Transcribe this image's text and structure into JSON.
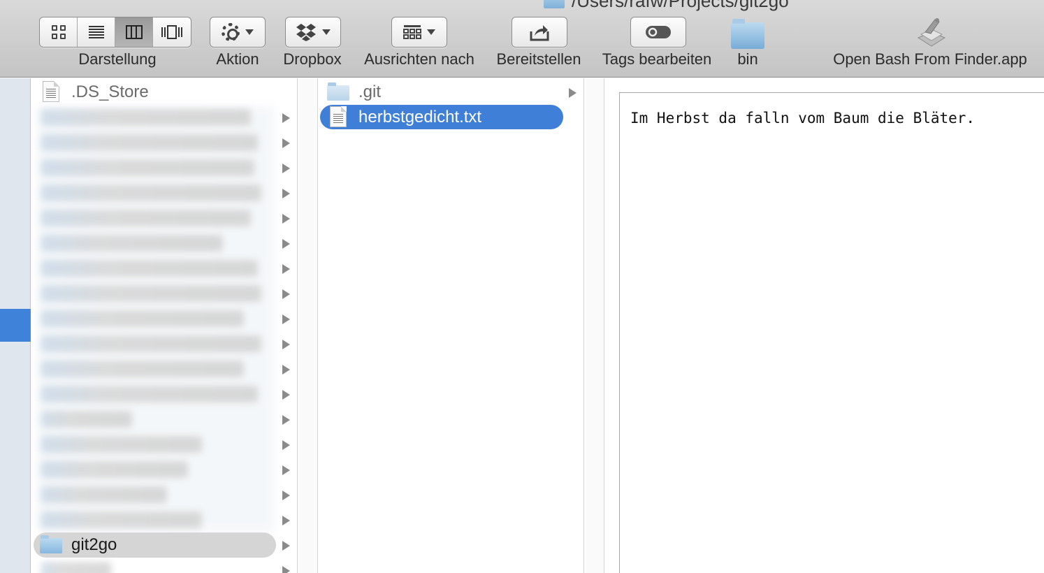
{
  "window": {
    "title_path": "/Users/rafw/Projects/git2go"
  },
  "toolbar": {
    "view_label": "Darstellung",
    "action_label": "Aktion",
    "dropbox_label": "Dropbox",
    "arrange_label": "Ausrichten nach",
    "share_label": "Bereitstellen",
    "tags_label": "Tags bearbeiten",
    "bin_label": "bin",
    "open_bash_label": "Open Bash From Finder.app",
    "active_view": "columns"
  },
  "column1": {
    "items": [
      {
        "name": ".DS_Store",
        "type": "file"
      },
      {
        "name": "git2go",
        "type": "folder",
        "selected": true
      }
    ]
  },
  "column2": {
    "items": [
      {
        "name": ".git",
        "type": "folder"
      },
      {
        "name": "herbstgedicht.txt",
        "type": "file",
        "selected": true
      }
    ]
  },
  "preview": {
    "text": "Im Herbst da falln vom Baum die Bläter."
  },
  "colors": {
    "selection_blue": "#3f7fd8",
    "selection_grey": "#d5d5d5",
    "folder_blue": "#86b6de"
  }
}
